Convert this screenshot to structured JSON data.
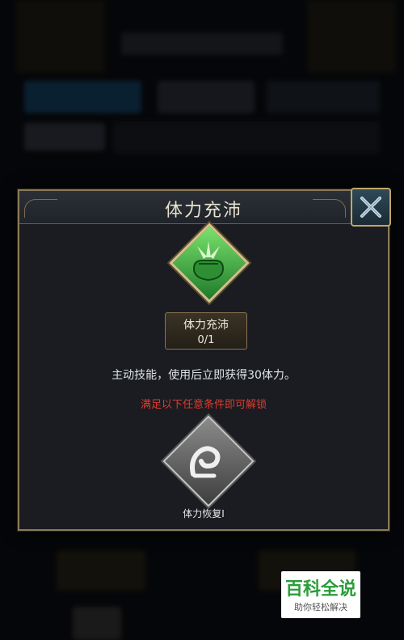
{
  "dialog": {
    "title": "体力充沛",
    "skill": {
      "name": "体力充沛",
      "count": "0/1"
    },
    "description": "主动技能，使用后立即获得30体力。",
    "condition": "满足以下任意条件即可解锁",
    "unlock_option": {
      "label": "体力恢复I"
    }
  },
  "watermark": {
    "top": "百科全说",
    "bottom": "助你轻松解决"
  },
  "colors": {
    "title_text": "#e8e1cf",
    "condition_red": "#e03a30",
    "frame_gold": "#8a7a57",
    "skill_green": "#4fb94a",
    "watermark_green": "#2a9d3a"
  },
  "icons": {
    "close": "close-x-icon",
    "skill": "fist-icon",
    "unlock": "arm-icon"
  }
}
